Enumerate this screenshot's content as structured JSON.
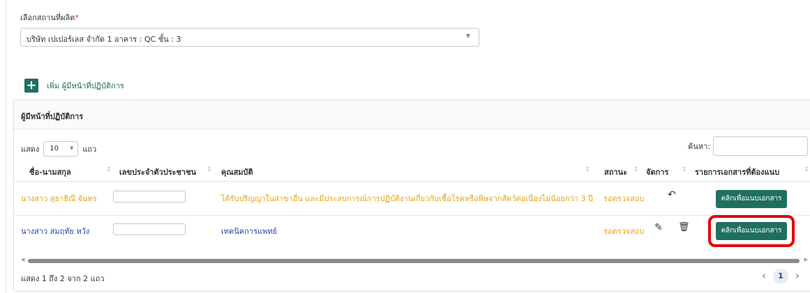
{
  "location": {
    "label": "เลือกสถานที่ผลิต",
    "required_mark": "*",
    "selected_value": "บริษัท เปเปอร์เลส จำกัด 1 อาคาร : QC ชั้น : 3"
  },
  "add_officer": {
    "icon": "plus-icon",
    "label": "เพิ่ม ผู้มีหน้าที่ปฏิบัติการ"
  },
  "card": {
    "title": "ผู้มีหน้าที่ปฏิบัติการ",
    "length": {
      "prefix": "แสดง",
      "value": "10",
      "suffix": "แถว"
    },
    "search_label": "ค้นหา:",
    "columns": [
      "ชื่อ-นามสกุล",
      "เลขประจำตัวประชาชน",
      "คุณสมบัติ",
      "สถานะ",
      "จัดการ",
      "รายการเอกสารที่ต้องแนบ"
    ],
    "rows": [
      {
        "name": "นางสาว สุธาธิณี จันทร",
        "citizen_id": "",
        "qualification": "ได้รับปริญญาในสาขาอื่น และมีประสบการณ์การปฏิบัติงานเกี่ยวกับเชื้อโรคหรือพิษจากสัตว์ต่อเนื่องไม่น้อยกว่า 3 ปี",
        "status": "รอตรวจสอบ",
        "actions": [
          "undo-icon"
        ],
        "attach_button": "คลิกเพื่อแนบเอกสาร",
        "color": "#e8a312"
      },
      {
        "name": "นางสาว สมฤทัย หวัง",
        "citizen_id": "",
        "qualification": "เทคนิคการแพทย์",
        "status": "รอตรวจสอบ",
        "actions": [
          "pencil-icon",
          "trash-icon"
        ],
        "attach_button": "คลิกเพื่อแนบเอกสาร",
        "color": "#2a3fa8"
      }
    ],
    "info": "แสดง 1 ถึง 2 จาก 2 แถว",
    "pagination": {
      "prev": "‹",
      "current": "1",
      "next": "›"
    }
  },
  "highlight_color": "#e30000"
}
